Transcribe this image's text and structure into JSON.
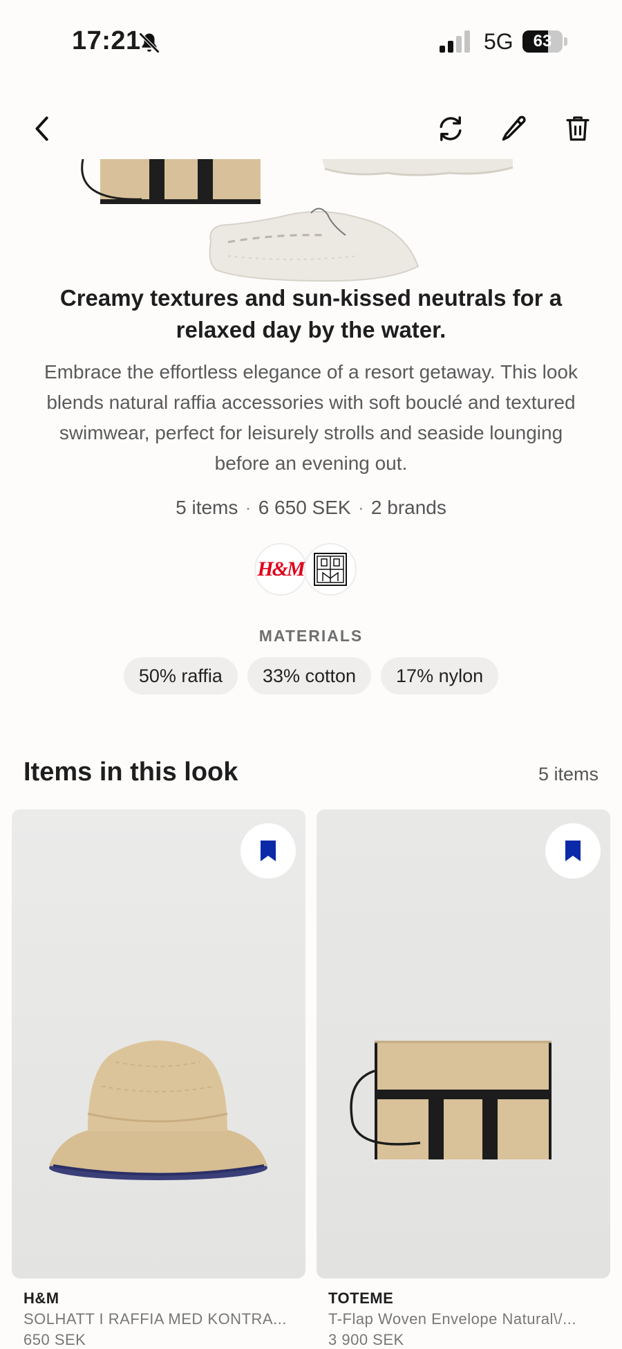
{
  "status_bar": {
    "time": "17:21",
    "network": "5G",
    "battery": "63",
    "battery_level": 0.63
  },
  "nav": {
    "back_icon": "chevron-left-icon",
    "actions": [
      "refresh-icon",
      "pencil-icon",
      "trash-icon"
    ]
  },
  "look": {
    "title": "Creamy textures and sun-kissed neutrals for a relaxed day by the water.",
    "description": "Embrace the effortless elegance of a resort getaway. This look blends natural raffia accessories with soft bouclé and textured swimwear, perfect for leisurely strolls and seaside lounging before an evening out.",
    "stats": {
      "items": "5 items",
      "price": "6 650 SEK",
      "brands": "2 brands",
      "separator": "·"
    },
    "brand_logos": {
      "hm": "H&M"
    }
  },
  "materials": {
    "heading": "MATERIALS",
    "chips": [
      "50% raffia",
      "33% cotton",
      "17% nylon"
    ]
  },
  "items_section": {
    "heading": "Items in this look",
    "count": "5 items",
    "products": [
      {
        "brand": "H&M",
        "name": "SOLHATT I RAFFIA MED KONTRA...",
        "price": "650 SEK"
      },
      {
        "brand": "TOTEME",
        "name": "T-Flap Woven Envelope Natural\\/...",
        "price": "3 900 SEK"
      }
    ]
  },
  "colors": {
    "accent_bookmark": "#0a2aa8",
    "hm_red": "#e1001a",
    "raffia": "#d8c19a"
  }
}
